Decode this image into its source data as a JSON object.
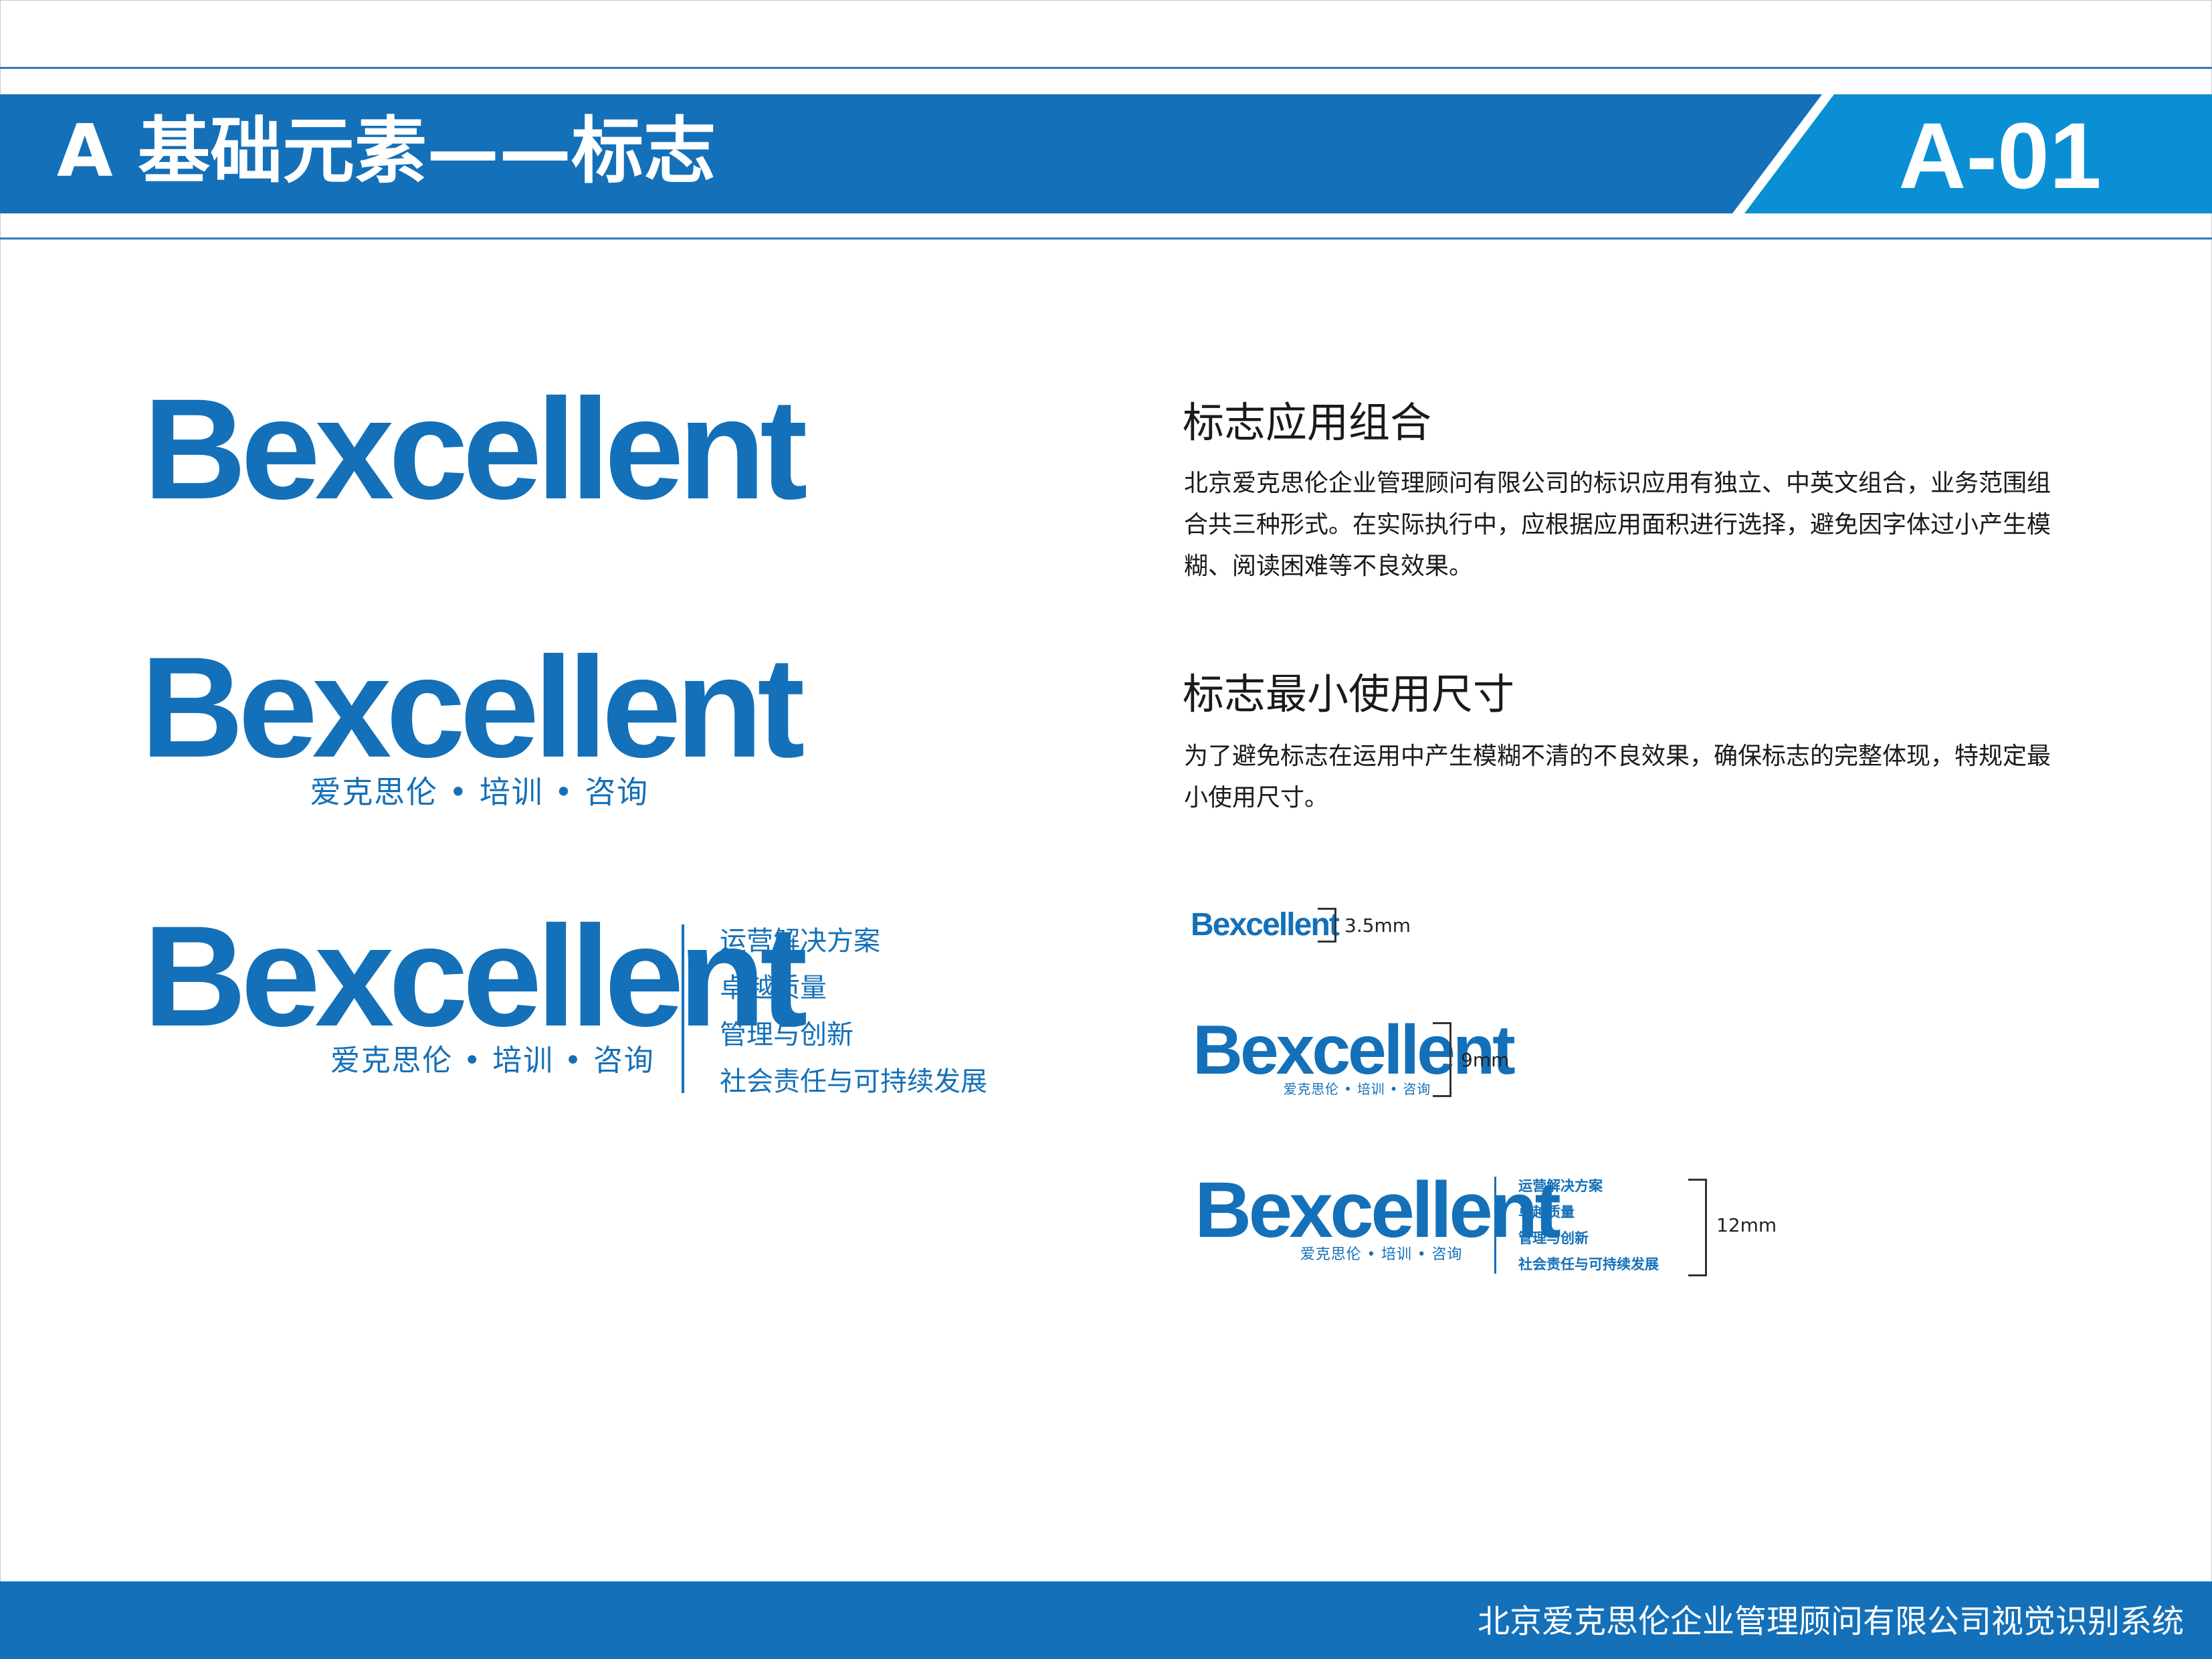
{
  "header": {
    "title": "A 基础元素——标志",
    "page_code": "A-01"
  },
  "logo": {
    "wordmark": "Bexcellent",
    "tagline": "爱克思伦 • 培训 • 咨询",
    "slogans": [
      "运营解决方案",
      "卓越质量",
      "管理与创新",
      "社会责任与可持续发展"
    ]
  },
  "sections": {
    "combination": {
      "title": "标志应用组合",
      "body": "北京爱克思伦企业管理顾问有限公司的标识应用有独立、中英文组合，业务范围组合共三种形式。在实际执行中，应根据应用面积进行选择，避免因字体过小产生模糊、阅读困难等不良效果。"
    },
    "min_size": {
      "title": "标志最小使用尺寸",
      "body": "为了避免标志在运用中产生模糊不清的不良效果，确保标志的完整体现，特规定最小使用尺寸。"
    }
  },
  "min_sizes": [
    "3.5mm",
    "9mm",
    "12mm"
  ],
  "footer": {
    "text": "北京爱克思伦企业管理顾问有限公司视觉识别系统"
  },
  "colors": {
    "brand_blue": "#1470b8",
    "accent_blue": "#0a8fd4",
    "text": "#1a1a1a",
    "background": "#ffffff"
  }
}
